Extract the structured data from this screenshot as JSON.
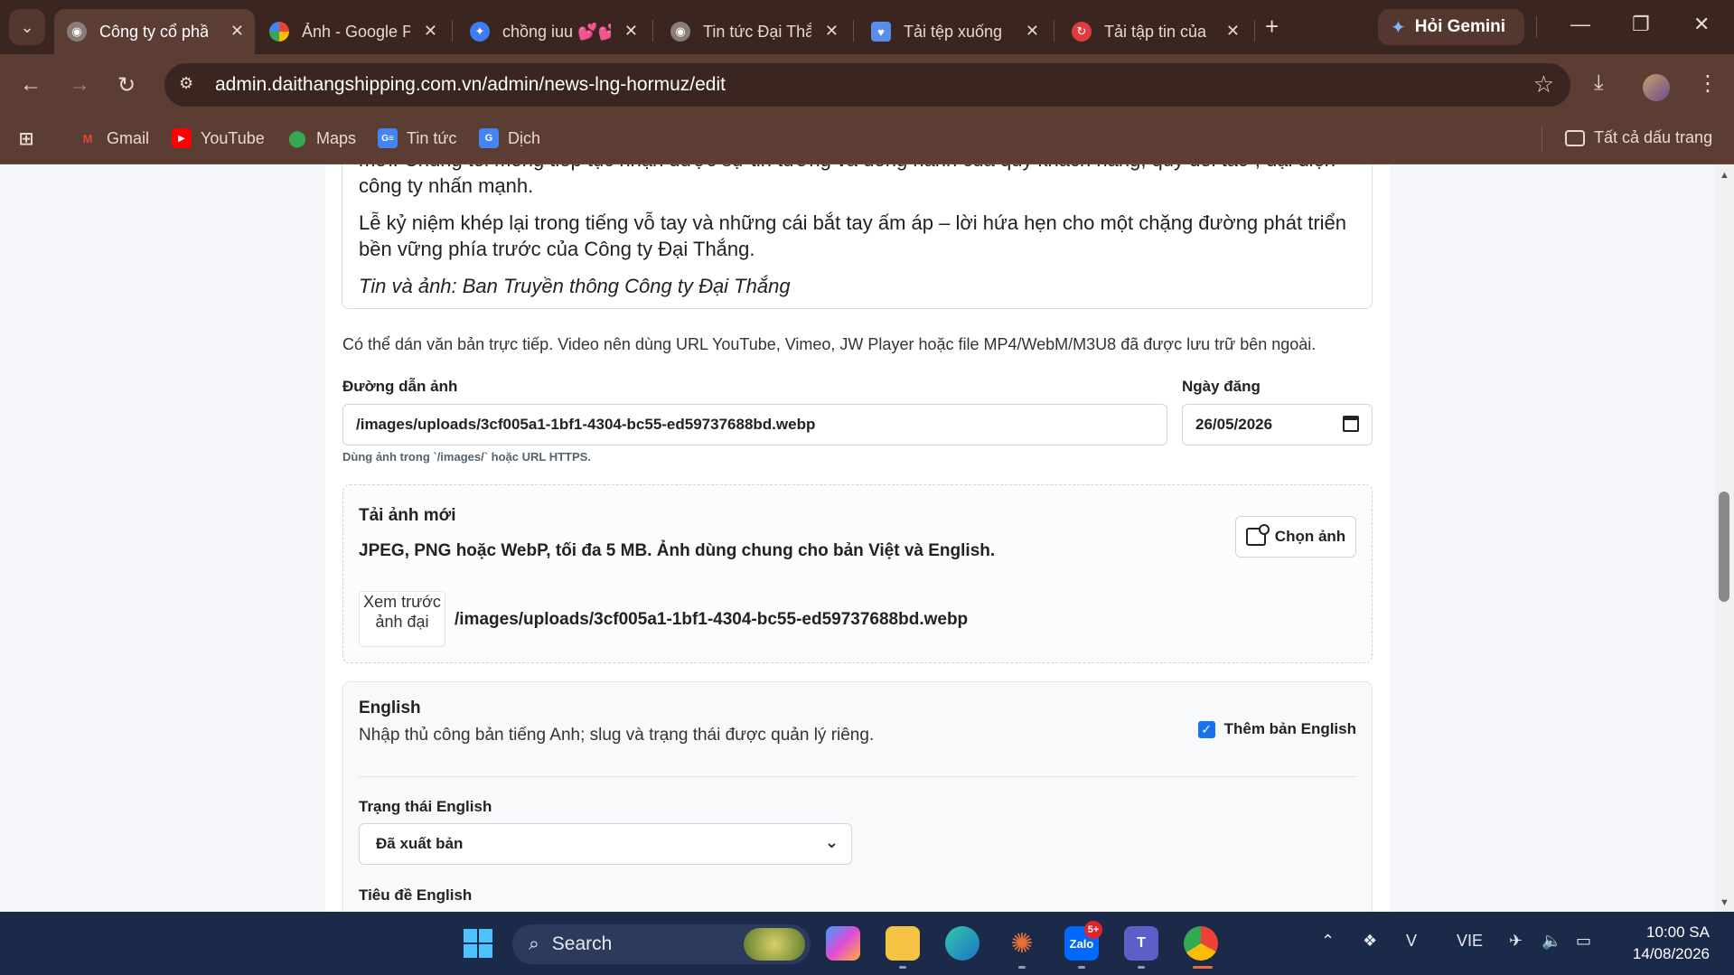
{
  "browser": {
    "tabs": [
      {
        "title": "Công ty cổ phần",
        "active": true
      },
      {
        "title": "Ảnh - Google Photos",
        "active": false
      },
      {
        "title": "chồng iuu 💕💕",
        "active": false
      },
      {
        "title": "Tin tức Đại Thắng",
        "active": false
      },
      {
        "title": "Tải tệp xuống",
        "active": false
      },
      {
        "title": "Tải tập tin của",
        "active": false
      }
    ],
    "gemini_label": "Hỏi Gemini",
    "url": "admin.daithangshipping.com.vn/admin/news-lng-hormuz/edit",
    "bookmarks": [
      "Gmail",
      "YouTube",
      "Maps",
      "Tin tức",
      "Dịch"
    ],
    "all_bookmarks_label": "Tất cả dấu trang"
  },
  "editor": {
    "line1": "mới. Chúng tôi mong tiếp tục nhận được sự tin tưởng và đồng hành của quý khách hàng, quý đối tác\", đại diện",
    "line2": "công ty nhấn mạnh.",
    "para2": "Lễ kỷ niệm khép lại trong tiếng vỗ tay và những cái bắt tay ấm áp – lời hứa hẹn cho một chặng đường phát triển bền vững phía trước của Công ty Đại Thắng.",
    "credit": "Tin và ảnh: Ban Truyền thông Công ty Đại Thắng"
  },
  "editor_hint": "Có thể dán văn bản trực tiếp. Video nên dùng URL YouTube, Vimeo, JW Player hoặc file MP4/WebM/M3U8 đã được lưu trữ bên ngoài.",
  "image_path": {
    "label": "Đường dẫn ảnh",
    "value": "/images/uploads/3cf005a1-1bf1-4304-bc55-ed59737688bd.webp",
    "hint": "Dùng ảnh trong `/images/` hoặc URL HTTPS."
  },
  "publish_date": {
    "label": "Ngày đăng",
    "value": "26/05/2026"
  },
  "upload": {
    "title": "Tải ảnh mới",
    "description": "JPEG, PNG hoặc WebP, tối đa 5 MB. Ảnh dùng chung cho bản Việt và English.",
    "button": "Chọn ảnh",
    "preview_alt": "Xem trước ảnh đại",
    "preview_path": "/images/uploads/3cf005a1-1bf1-4304-bc55-ed59737688bd.webp"
  },
  "english": {
    "title": "English",
    "description": "Nhập thủ công bản tiếng Anh; slug và trạng thái được quản lý riêng.",
    "checkbox_label": "Thêm bản English",
    "checked": true,
    "status_label": "Trạng thái English",
    "status_value": "Đã xuất bản",
    "title_label": "Tiêu đề English"
  },
  "taskbar": {
    "search_placeholder": "Search",
    "zalo_badge": "5+",
    "language": "VIE",
    "time": "10:00 SA",
    "date": "14/08/2026"
  },
  "colors": {
    "tab_bar": "#3a2520",
    "toolbar": "#5b3d33",
    "checkbox_accent": "#1a73e8",
    "taskbar": "#1c2a4a"
  }
}
